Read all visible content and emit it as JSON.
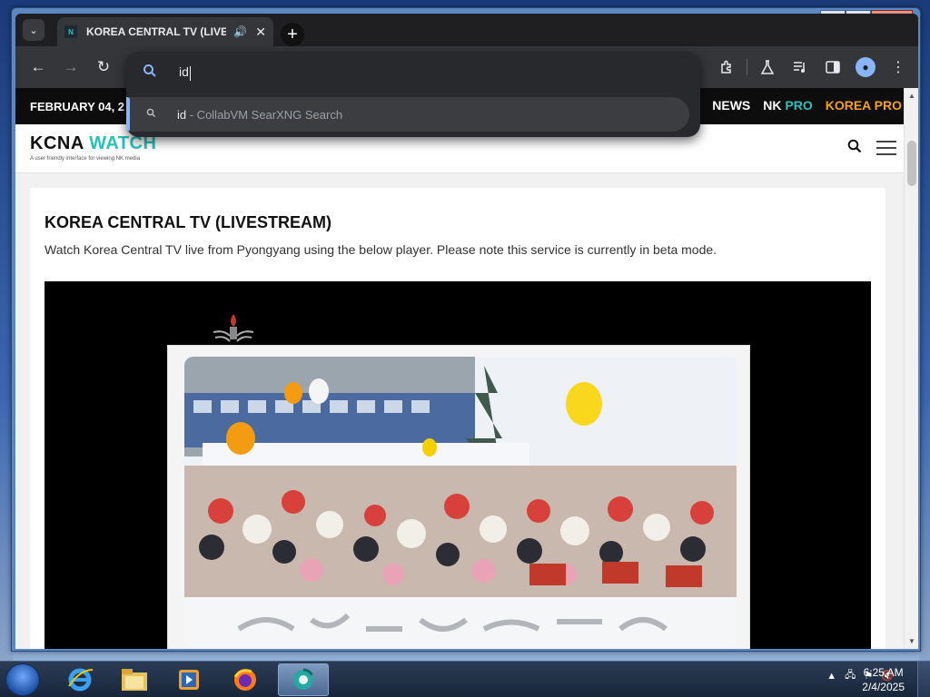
{
  "browser": {
    "tab_title": "KOREA CENTRAL TV (LIVES",
    "tab_favicon": "N",
    "address_input": "id",
    "suggestion": {
      "query": "id",
      "source": " - CollabVM SearXNG Search"
    }
  },
  "site": {
    "date": "FEBRUARY 04, 2",
    "nav": {
      "news": "NEWS",
      "nk": "NK",
      "nk_pro": "PRO",
      "korea_pro": "KOREA PRO"
    },
    "logo_main": "KCNA",
    "logo_accent": "WATCH",
    "logo_tagline": "A user friendly interface for viewing NK media"
  },
  "page": {
    "title": "KOREA CENTRAL TV (LIVESTREAM)",
    "description": "Watch Korea Central TV live from Pyongyang using the below player. Please note this service is currently in beta mode."
  },
  "taskbar": {
    "time": "6:25 AM",
    "date": "2/4/2025"
  },
  "colors": {
    "accent_teal": "#27c2b8",
    "korea_pro_orange": "#f5a21a",
    "chrome_dark": "#35363a"
  },
  "icons": [
    "tab-search-icon",
    "audio-icon",
    "close-icon",
    "new-tab-icon",
    "back-icon",
    "forward-icon",
    "reload-icon",
    "search-icon",
    "extensions-icon",
    "labs-icon",
    "media-icon",
    "sidepanel-icon",
    "profile-icon",
    "menu-icon",
    "hamburger-icon"
  ]
}
